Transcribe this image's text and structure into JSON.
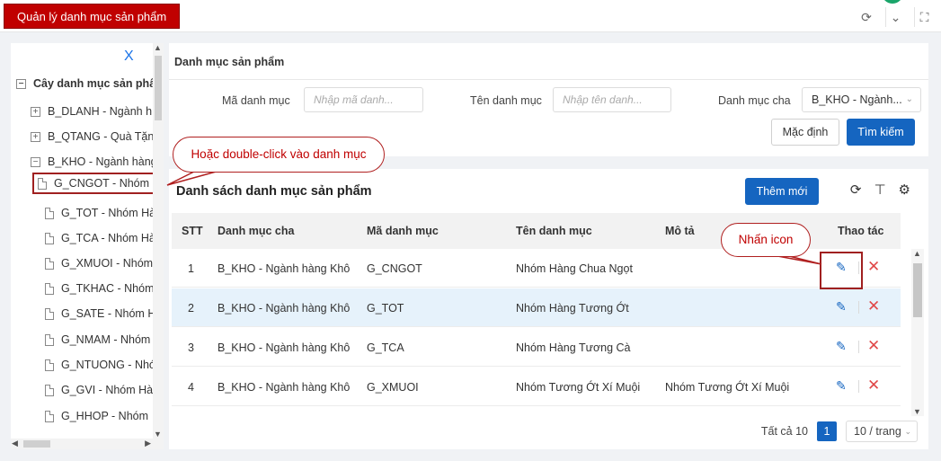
{
  "app": {
    "title": "Quản lý danh mục sản phẩm"
  },
  "topbar_icons": [
    "refresh-icon",
    "chevron-down-icon",
    "fullscreen-icon"
  ],
  "tree": {
    "close_label": "X",
    "root": "Cây danh mục sản phẩm",
    "items": [
      {
        "label": "B_DLANH - Ngành h",
        "kind": "folder",
        "expanded": false
      },
      {
        "label": "B_QTANG - Quà Tặng",
        "kind": "folder",
        "expanded": false
      },
      {
        "label": "B_KHO - Ngành hàng",
        "kind": "folder",
        "expanded": true
      },
      {
        "label": "G_CNGOT - Nhóm",
        "kind": "leaf",
        "selected": true
      },
      {
        "label": "G_TOT - Nhóm Hà",
        "kind": "leaf"
      },
      {
        "label": "G_TCA - Nhóm Hà",
        "kind": "leaf"
      },
      {
        "label": "G_XMUOI - Nhóm",
        "kind": "leaf"
      },
      {
        "label": "G_TKHAC - Nhóm",
        "kind": "leaf"
      },
      {
        "label": "G_SATE - Nhóm H",
        "kind": "leaf"
      },
      {
        "label": "G_NMAM - Nhóm",
        "kind": "leaf"
      },
      {
        "label": "G_NTUONG - Nhó",
        "kind": "leaf"
      },
      {
        "label": "G_GVI - Nhóm Hà",
        "kind": "leaf"
      },
      {
        "label": "G_HHOP - Nhóm",
        "kind": "leaf"
      }
    ]
  },
  "search": {
    "title": "Danh mục sản phẩm",
    "code_label": "Mã danh mục",
    "code_placeholder": "Nhập mã danh...",
    "name_label": "Tên danh mục",
    "name_placeholder": "Nhập tên danh...",
    "parent_label": "Danh mục cha",
    "parent_value": "B_KHO - Ngành...",
    "default_button": "Mặc định",
    "search_button": "Tìm kiếm"
  },
  "list": {
    "title": "Danh sách danh mục sản phẩm",
    "add_button": "Thêm mới",
    "tool_icons": [
      "refresh-icon",
      "column-height-icon",
      "settings-icon"
    ],
    "columns": [
      "STT",
      "Danh mục cha",
      "Mã danh mục",
      "Tên danh mục",
      "Mô tả",
      "Thao tác"
    ],
    "rows": [
      {
        "stt": "1",
        "parent": "B_KHO - Ngành hàng Khô",
        "code": "G_CNGOT",
        "name": "Nhóm Hàng Chua Ngọt",
        "desc": ""
      },
      {
        "stt": "2",
        "parent": "B_KHO - Ngành hàng Khô",
        "code": "G_TOT",
        "name": "Nhóm Hàng Tương Ớt",
        "desc": ""
      },
      {
        "stt": "3",
        "parent": "B_KHO - Ngành hàng Khô",
        "code": "G_TCA",
        "name": "Nhóm Hàng Tương Cà",
        "desc": ""
      },
      {
        "stt": "4",
        "parent": "B_KHO - Ngành hàng Khô",
        "code": "G_XMUOI",
        "name": "Nhóm Tương Ớt Xí Muội",
        "desc": "Nhóm Tương Ớt Xí Muội"
      }
    ],
    "total_label": "Tất cả 10",
    "current_page": "1",
    "page_size": "10 / trang"
  },
  "callouts": {
    "double_click": "Hoặc double-click vào danh mục",
    "click_icon": "Nhấn icon"
  },
  "colors": {
    "brand_red": "#c00000",
    "primary_blue": "#1565c0",
    "delete_red": "#e04848",
    "callout_border": "#b02020"
  }
}
